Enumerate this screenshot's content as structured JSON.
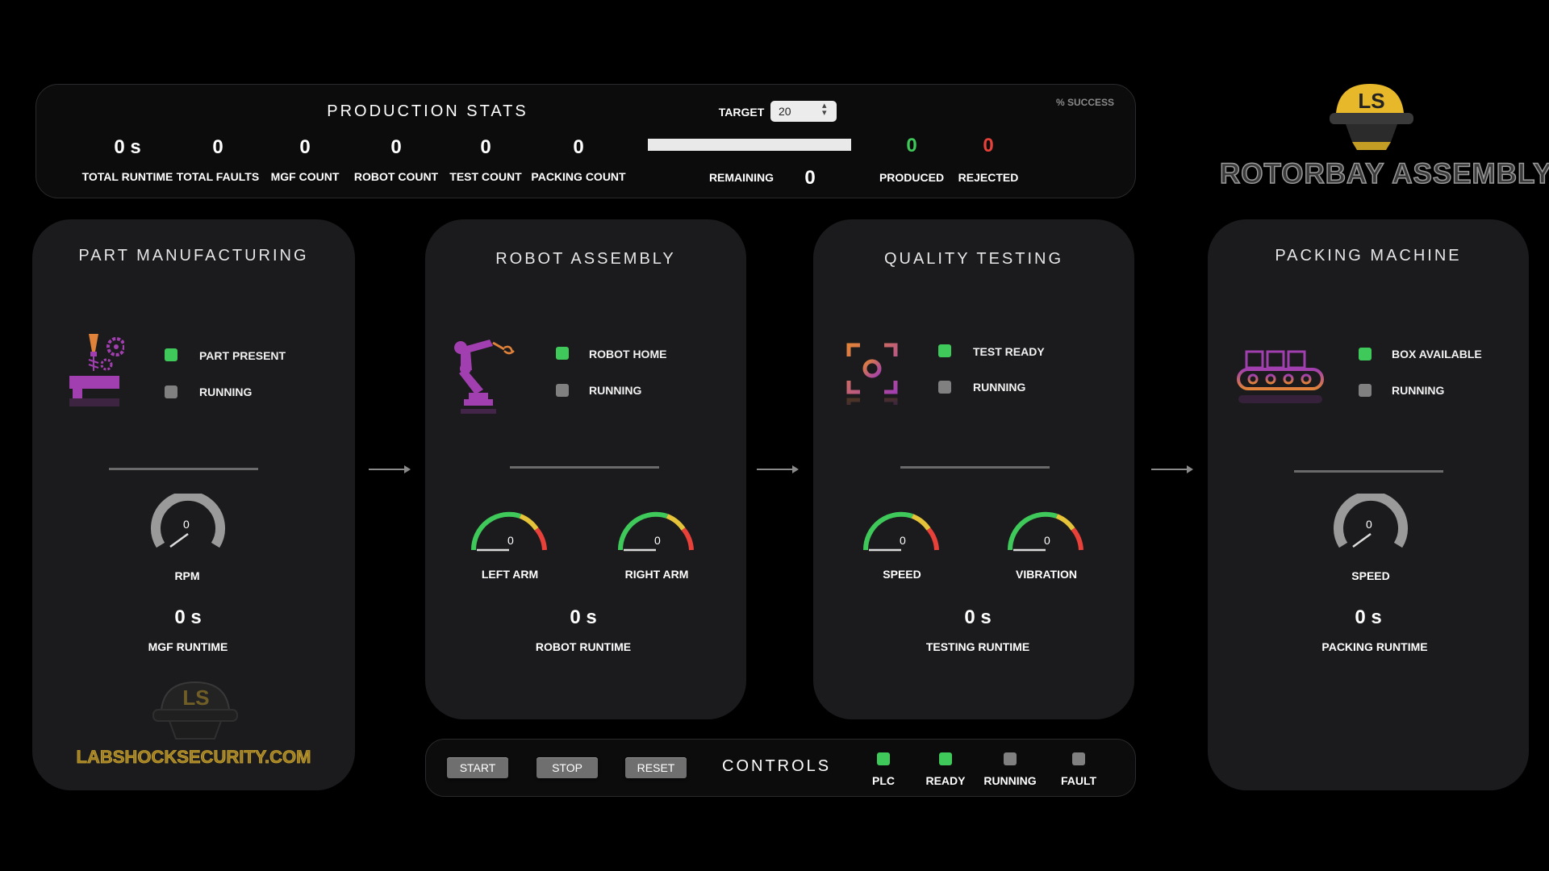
{
  "stats": {
    "title": "PRODUCTION STATS",
    "items": [
      {
        "value": "0 s",
        "label": "TOTAL RUNTIME"
      },
      {
        "value": "0",
        "label": "TOTAL FAULTS"
      },
      {
        "value": "0",
        "label": "MGF COUNT"
      },
      {
        "value": "0",
        "label": "ROBOT COUNT"
      },
      {
        "value": "0",
        "label": "TEST COUNT"
      },
      {
        "value": "0",
        "label": "PACKING COUNT"
      }
    ],
    "target_label": "TARGET",
    "target_value": "20",
    "progress": 0,
    "remaining_label": "REMAINING",
    "remaining_value": "0",
    "produced_value": "0",
    "produced_label": "PRODUCED",
    "rejected_value": "0",
    "rejected_label": "REJECTED",
    "success_label": "% SUCCESS"
  },
  "brand": {
    "logo_letters": "LS",
    "title": "ROTORBAY ASSEMBLY",
    "website": "LABSHOCKSECURITY.COM"
  },
  "stations": [
    {
      "title": "PART MANUFACTURING",
      "icon": "manufacturing-icon",
      "indicators": [
        {
          "label": "PART PRESENT",
          "on": true
        },
        {
          "label": "RUNNING",
          "on": false
        }
      ],
      "gauges": [
        {
          "label": "RPM",
          "value": "0",
          "type": "grey"
        }
      ],
      "runtime_value": "0 s",
      "runtime_label": "MGF RUNTIME"
    },
    {
      "title": "ROBOT ASSEMBLY",
      "icon": "robot-arm-icon",
      "indicators": [
        {
          "label": "ROBOT HOME",
          "on": true
        },
        {
          "label": "RUNNING",
          "on": false
        }
      ],
      "gauges": [
        {
          "label": "LEFT ARM",
          "value": "0",
          "type": "color"
        },
        {
          "label": "RIGHT ARM",
          "value": "0",
          "type": "color"
        }
      ],
      "runtime_value": "0 s",
      "runtime_label": "ROBOT RUNTIME"
    },
    {
      "title": "QUALITY TESTING",
      "icon": "camera-focus-icon",
      "indicators": [
        {
          "label": "TEST READY",
          "on": true
        },
        {
          "label": "RUNNING",
          "on": false
        }
      ],
      "gauges": [
        {
          "label": "SPEED",
          "value": "0",
          "type": "color"
        },
        {
          "label": "VIBRATION",
          "value": "0",
          "type": "color"
        }
      ],
      "runtime_value": "0 s",
      "runtime_label": "TESTING RUNTIME"
    },
    {
      "title": "PACKING MACHINE",
      "icon": "conveyor-icon",
      "indicators": [
        {
          "label": "BOX AVAILABLE",
          "on": true
        },
        {
          "label": "RUNNING",
          "on": false
        }
      ],
      "gauges": [
        {
          "label": "SPEED",
          "value": "0",
          "type": "grey"
        }
      ],
      "runtime_value": "0 s",
      "runtime_label": "PACKING RUNTIME"
    }
  ],
  "controls": {
    "title": "CONTROLS",
    "buttons": [
      "START",
      "STOP",
      "RESET"
    ],
    "indicators": [
      {
        "label": "PLC",
        "on": true
      },
      {
        "label": "READY",
        "on": true
      },
      {
        "label": "RUNNING",
        "on": false
      },
      {
        "label": "FAULT",
        "on": false
      }
    ]
  },
  "colors": {
    "on": "#3fc95a",
    "off": "#808080",
    "produced": "#3fc95a",
    "rejected": "#e8413a",
    "icon_purple": "#a23fb0",
    "icon_orange": "#e0823a",
    "brand_gold": "#c7a12f"
  }
}
